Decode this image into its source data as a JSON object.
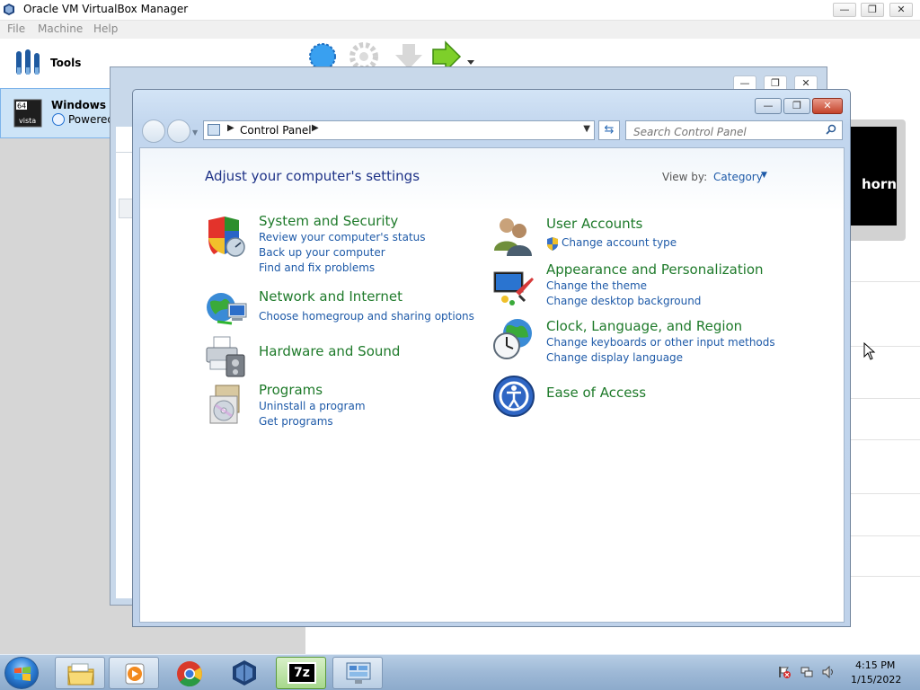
{
  "vbox": {
    "title": "Oracle VM VirtualBox Manager",
    "menu": [
      "File",
      "Machine",
      "Help"
    ],
    "tools_label": "Tools",
    "vm_name": "Windows Lo",
    "vm_state": "Powered C",
    "vm_badge_top": "64",
    "vm_badge_bottom": "vista",
    "preview_text": "horn"
  },
  "control_panel": {
    "breadcrumb": "Control Panel",
    "search_placeholder": "Search Control Panel",
    "heading": "Adjust your computer's settings",
    "view_by_label": "View by:",
    "view_by_value": "Category",
    "categories_left": [
      {
        "title": "System and Security",
        "links": [
          "Review your computer's status",
          "Back up your computer",
          "Find and fix problems"
        ]
      },
      {
        "title": "Network and Internet",
        "links": [
          "Choose homegroup and sharing options"
        ]
      },
      {
        "title": "Hardware and Sound",
        "links": []
      },
      {
        "title": "Programs",
        "links": [
          "Uninstall a program",
          "Get programs"
        ]
      }
    ],
    "categories_right": [
      {
        "title": "User Accounts",
        "links": [
          "Change account type"
        ]
      },
      {
        "title": "Appearance and Personalization",
        "links": [
          "Change the theme",
          "Change desktop background"
        ]
      },
      {
        "title": "Clock, Language, and Region",
        "links": [
          "Change keyboards or other input methods",
          "Change display language"
        ]
      },
      {
        "title": "Ease of Access",
        "links": []
      }
    ]
  },
  "taskbar": {
    "sevenzip_label": "7z",
    "time": "4:15 PM",
    "date": "1/15/2022"
  },
  "colors": {
    "category_title": "#1e7a2a",
    "link": "#1e5aa8",
    "heading": "#1e3287"
  }
}
